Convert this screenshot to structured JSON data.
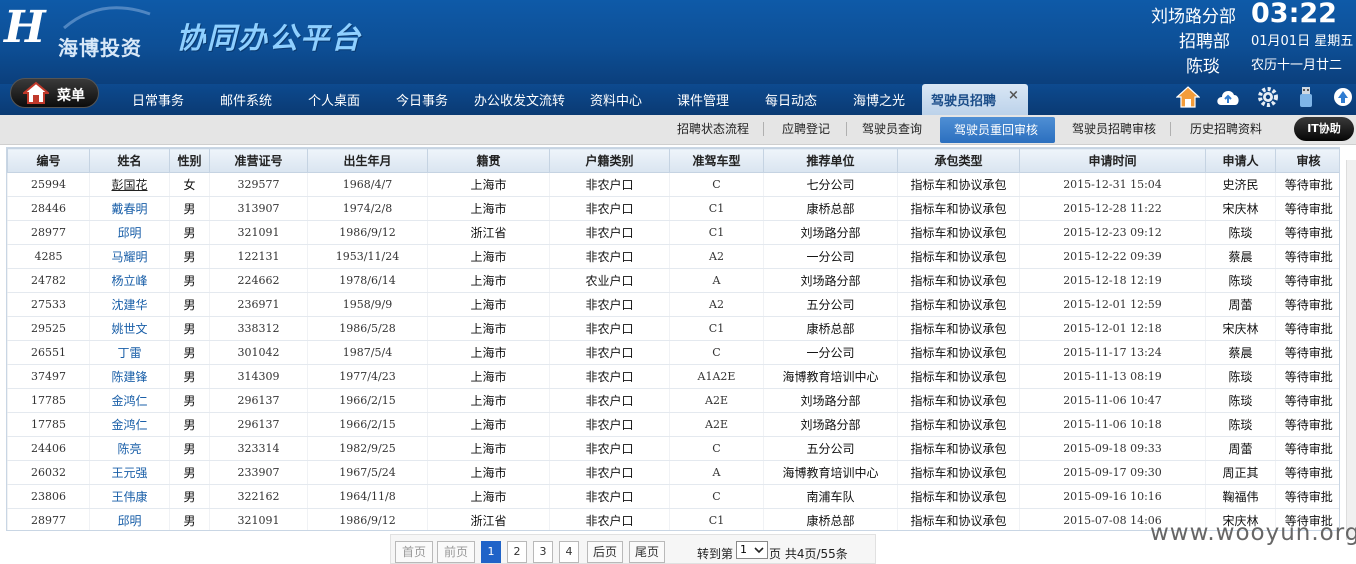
{
  "header": {
    "logo_text": "海博投资",
    "app_title": "协同办公平台",
    "org": "刘场路分部",
    "dept": "招聘部",
    "user": "陈琰",
    "time": "03:22",
    "date": "01月01日 星期五",
    "lunar": "农历十一月廿二"
  },
  "nav": {
    "menu_label": "菜单",
    "items": [
      "日常事务",
      "邮件系统",
      "个人桌面",
      "今日事务",
      "办公收发文流转",
      "资料中心",
      "课件管理",
      "每日动态",
      "海博之光"
    ],
    "active_label": "驾驶员招聘",
    "active_close": "×",
    "icons": [
      "home-icon",
      "cloud-upload-icon",
      "gear-icon",
      "usb-icon",
      "arrow-up-icon"
    ]
  },
  "subtabs": {
    "items": [
      "招聘状态流程",
      "应聘登记",
      "驾驶员查询"
    ],
    "active": "驾驶员重回审核",
    "items_after": [
      "驾驶员招聘审核",
      "历史招聘资料"
    ],
    "it_button": "IT协助"
  },
  "table": {
    "headers": [
      "编号",
      "姓名",
      "性别",
      "准营证号",
      "出生年月",
      "籍贯",
      "户籍类别",
      "准驾车型",
      "推荐单位",
      "承包类型",
      "申请时间",
      "申请人",
      "审核"
    ],
    "rows": [
      [
        "25994",
        "彭国花",
        "女",
        "329577",
        "1968/4/7",
        "上海市",
        "非农户口",
        "C",
        "七分公司",
        "指标车和协议承包",
        "2015-12-31 15:04",
        "史济民",
        "等待审批"
      ],
      [
        "28446",
        "戴春明",
        "男",
        "313907",
        "1974/2/8",
        "上海市",
        "非农户口",
        "C1",
        "康桥总部",
        "指标车和协议承包",
        "2015-12-28 11:22",
        "宋庆林",
        "等待审批"
      ],
      [
        "28977",
        "邱明",
        "男",
        "321091",
        "1986/9/12",
        "浙江省",
        "非农户口",
        "C1",
        "刘场路分部",
        "指标车和协议承包",
        "2015-12-23 09:12",
        "陈琰",
        "等待审批"
      ],
      [
        "4285",
        "马耀明",
        "男",
        "122131",
        "1953/11/24",
        "上海市",
        "非农户口",
        "A2",
        "一分公司",
        "指标车和协议承包",
        "2015-12-22 09:39",
        "蔡晨",
        "等待审批"
      ],
      [
        "24782",
        "杨立峰",
        "男",
        "224662",
        "1978/6/14",
        "上海市",
        "农业户口",
        "A",
        "刘场路分部",
        "指标车和协议承包",
        "2015-12-18 12:19",
        "陈琰",
        "等待审批"
      ],
      [
        "27533",
        "沈建华",
        "男",
        "236971",
        "1958/9/9",
        "上海市",
        "非农户口",
        "A2",
        "五分公司",
        "指标车和协议承包",
        "2015-12-01 12:59",
        "周蕾",
        "等待审批"
      ],
      [
        "29525",
        "姚世文",
        "男",
        "338312",
        "1986/5/28",
        "上海市",
        "非农户口",
        "C1",
        "康桥总部",
        "指标车和协议承包",
        "2015-12-01 12:18",
        "宋庆林",
        "等待审批"
      ],
      [
        "26551",
        "丁雷",
        "男",
        "301042",
        "1987/5/4",
        "上海市",
        "非农户口",
        "C",
        "一分公司",
        "指标车和协议承包",
        "2015-11-17 13:24",
        "蔡晨",
        "等待审批"
      ],
      [
        "37497",
        "陈建锋",
        "男",
        "314309",
        "1977/4/23",
        "上海市",
        "非农户口",
        "A1A2E",
        "海博教育培训中心",
        "指标车和协议承包",
        "2015-11-13 08:19",
        "陈琰",
        "等待审批"
      ],
      [
        "17785",
        "金鸿仁",
        "男",
        "296137",
        "1966/2/15",
        "上海市",
        "非农户口",
        "A2E",
        "刘场路分部",
        "指标车和协议承包",
        "2015-11-06 10:47",
        "陈琰",
        "等待审批"
      ],
      [
        "17785",
        "金鸿仁",
        "男",
        "296137",
        "1966/2/15",
        "上海市",
        "非农户口",
        "A2E",
        "刘场路分部",
        "指标车和协议承包",
        "2015-11-06 10:18",
        "陈琰",
        "等待审批"
      ],
      [
        "24406",
        "陈亮",
        "男",
        "323314",
        "1982/9/25",
        "上海市",
        "非农户口",
        "C",
        "五分公司",
        "指标车和协议承包",
        "2015-09-18 09:33",
        "周蕾",
        "等待审批"
      ],
      [
        "26032",
        "王元强",
        "男",
        "233907",
        "1967/5/24",
        "上海市",
        "非农户口",
        "A",
        "海博教育培训中心",
        "指标车和协议承包",
        "2015-09-17 09:30",
        "周正其",
        "等待审批"
      ],
      [
        "23806",
        "王伟康",
        "男",
        "322162",
        "1964/11/8",
        "上海市",
        "非农户口",
        "C",
        "南浦车队",
        "指标车和协议承包",
        "2015-09-16 10:16",
        "鞠福伟",
        "等待审批"
      ],
      [
        "28977",
        "邱明",
        "男",
        "321091",
        "1986/9/12",
        "浙江省",
        "非农户口",
        "C1",
        "康桥总部",
        "指标车和协议承包",
        "2015-07-08 14:06",
        "宋庆林",
        "等待审批"
      ]
    ]
  },
  "pager": {
    "first": "首页",
    "prev": "前页",
    "pages": [
      "1",
      "2",
      "3",
      "4"
    ],
    "current_page": "1",
    "next": "后页",
    "last": "尾页",
    "goto_prefix": "转到第",
    "goto_value": "1",
    "goto_suffix": "页 共4页/55条"
  },
  "watermark": "www.wooyun.org",
  "colors": {
    "header_blue": "#0d4f96",
    "active_tab": "#2b6fbf",
    "link_blue": "#1a5fa8",
    "current_page": "#1f63c8"
  }
}
